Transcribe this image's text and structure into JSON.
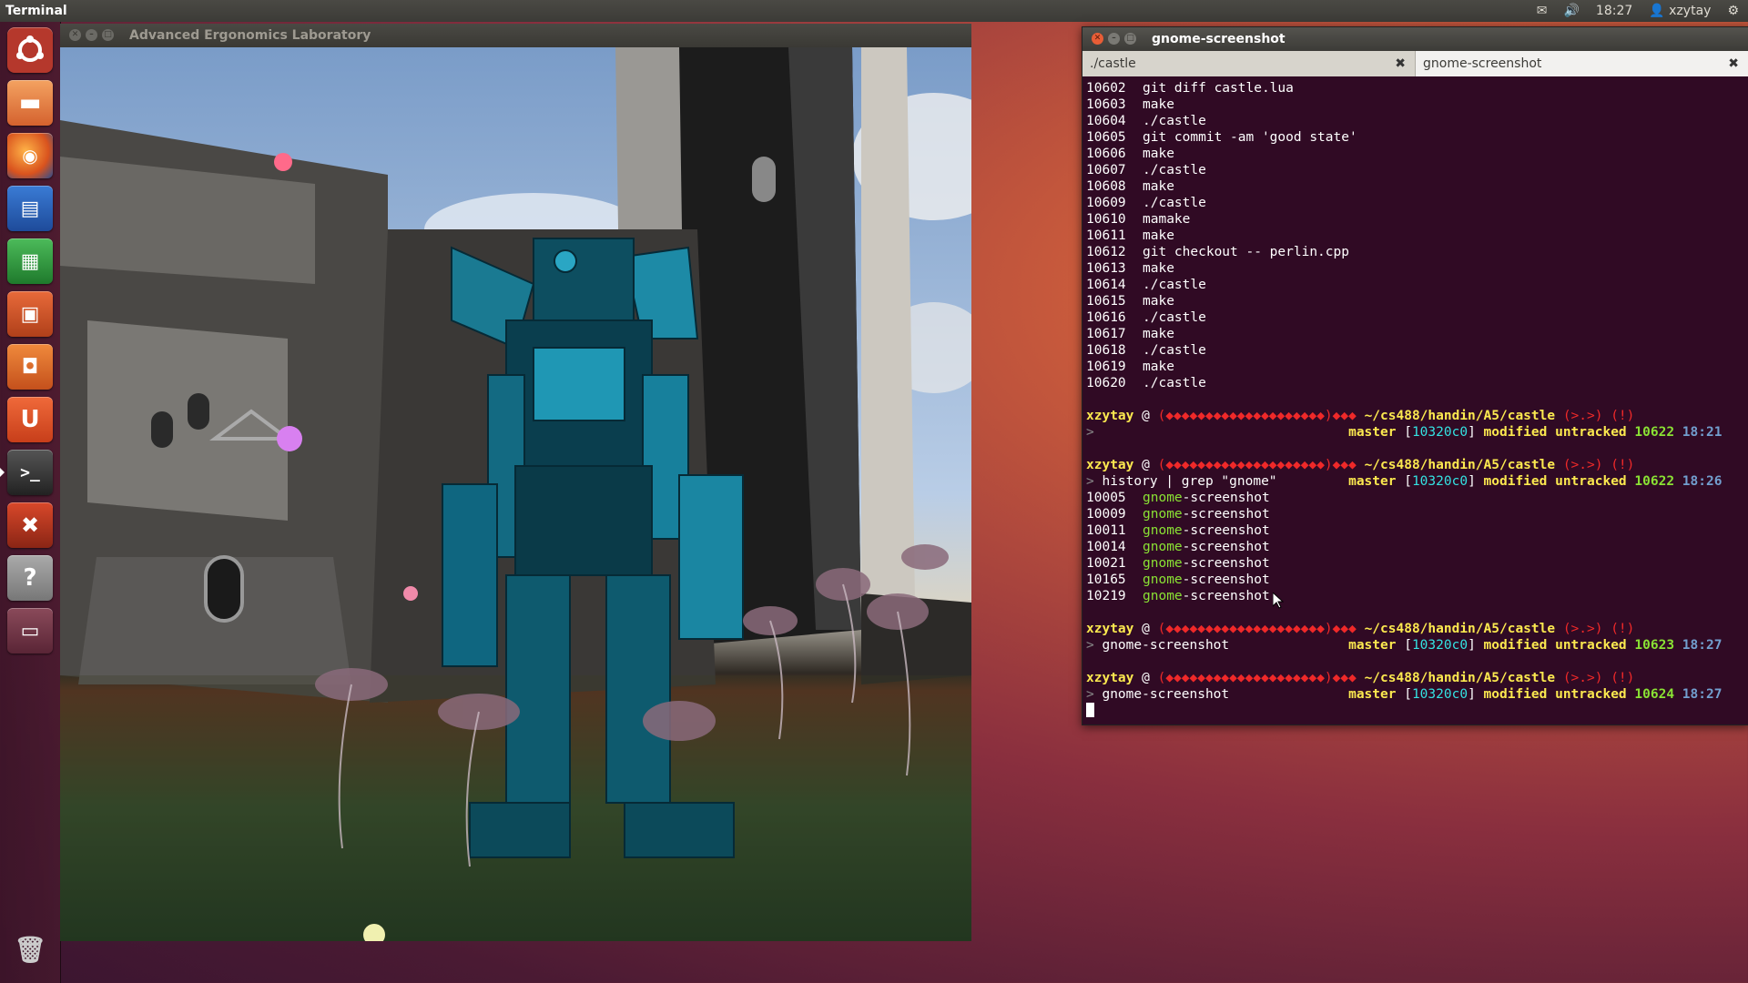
{
  "top_panel": {
    "app_name": "Terminal",
    "time": "18:27",
    "user": "xzytay",
    "mail_icon": "mail-icon",
    "volume_icon": "volume-icon",
    "gear_icon": "gear-icon"
  },
  "launcher": {
    "items": [
      {
        "name": "dash-home",
        "icon": "ubuntu-logo-icon"
      },
      {
        "name": "files",
        "icon": "folder-icon"
      },
      {
        "name": "firefox",
        "icon": "firefox-icon"
      },
      {
        "name": "writer",
        "icon": "document-icon"
      },
      {
        "name": "calc",
        "icon": "spreadsheet-icon"
      },
      {
        "name": "impress",
        "icon": "presentation-icon"
      },
      {
        "name": "software-center",
        "icon": "shopping-bag-icon"
      },
      {
        "name": "ubuntu-one",
        "icon": "u-icon"
      },
      {
        "name": "terminal",
        "icon": "terminal-icon"
      },
      {
        "name": "system-settings",
        "icon": "settings-icon"
      },
      {
        "name": "help",
        "icon": "help-icon"
      },
      {
        "name": "workspaces",
        "icon": "workspace-icon"
      },
      {
        "name": "trash",
        "icon": "trash-icon"
      }
    ]
  },
  "game_window": {
    "title": "Advanced Ergonomics Laboratory"
  },
  "terminal": {
    "title": "gnome-screenshot",
    "tabs": [
      {
        "label": "./castle",
        "active": false
      },
      {
        "label": "gnome-screenshot",
        "active": true
      }
    ],
    "history": [
      {
        "num": "10602",
        "cmd": "git diff castle.lua"
      },
      {
        "num": "10603",
        "cmd": "make"
      },
      {
        "num": "10604",
        "cmd": "./castle"
      },
      {
        "num": "10605",
        "cmd": "git commit -am 'good state'"
      },
      {
        "num": "10606",
        "cmd": "make"
      },
      {
        "num": "10607",
        "cmd": "./castle"
      },
      {
        "num": "10608",
        "cmd": "make"
      },
      {
        "num": "10609",
        "cmd": "./castle"
      },
      {
        "num": "10610",
        "cmd": "mamake"
      },
      {
        "num": "10611",
        "cmd": "make"
      },
      {
        "num": "10612",
        "cmd": "git checkout -- perlin.cpp"
      },
      {
        "num": "10613",
        "cmd": "make"
      },
      {
        "num": "10614",
        "cmd": "./castle"
      },
      {
        "num": "10615",
        "cmd": "make"
      },
      {
        "num": "10616",
        "cmd": "./castle"
      },
      {
        "num": "10617",
        "cmd": "make"
      },
      {
        "num": "10618",
        "cmd": "./castle"
      },
      {
        "num": "10619",
        "cmd": "make"
      },
      {
        "num": "10620",
        "cmd": "./castle"
      }
    ],
    "prompt": {
      "user": "xzytay",
      "at": "@",
      "battery": "(◆◆◆◆◆◆◆◆◆◆◆◆◆◆◆◆◆◆◆◆)◆◆◆",
      "path": "~/cs488/handin/A5/castle",
      "face": "(>.>)",
      "bang": "(!)",
      "branch": "master",
      "hash": "[10320c0]",
      "modified": "modified",
      "untracked": "untracked"
    },
    "prompt_blocks": [
      {
        "cmd": "",
        "hist": "10622",
        "time": "18:21"
      },
      {
        "cmd": "history | grep \"gnome\"",
        "hist": "10622",
        "time": "18:26"
      }
    ],
    "grep_results": [
      {
        "num": "10005",
        "match": "gnome",
        "rest": "-screenshot"
      },
      {
        "num": "10009",
        "match": "gnome",
        "rest": "-screenshot"
      },
      {
        "num": "10011",
        "match": "gnome",
        "rest": "-screenshot"
      },
      {
        "num": "10014",
        "match": "gnome",
        "rest": "-screenshot"
      },
      {
        "num": "10021",
        "match": "gnome",
        "rest": "-screenshot"
      },
      {
        "num": "10165",
        "match": "gnome",
        "rest": "-screenshot"
      },
      {
        "num": "10219",
        "match": "gnome",
        "rest": "-screenshot"
      }
    ],
    "prompt_blocks_after": [
      {
        "cmd": "gnome-screenshot",
        "hist": "10623",
        "time": "18:27"
      },
      {
        "cmd": "gnome-screenshot",
        "hist": "10624",
        "time": "18:27"
      }
    ]
  },
  "colors": {
    "terminal_bg": "#300a24",
    "prompt_user": "#fce94f",
    "prompt_battery": "#ef2929",
    "branch_hash": "#34e2e2",
    "grep_match": "#8ae234",
    "time": "#729fcf"
  }
}
